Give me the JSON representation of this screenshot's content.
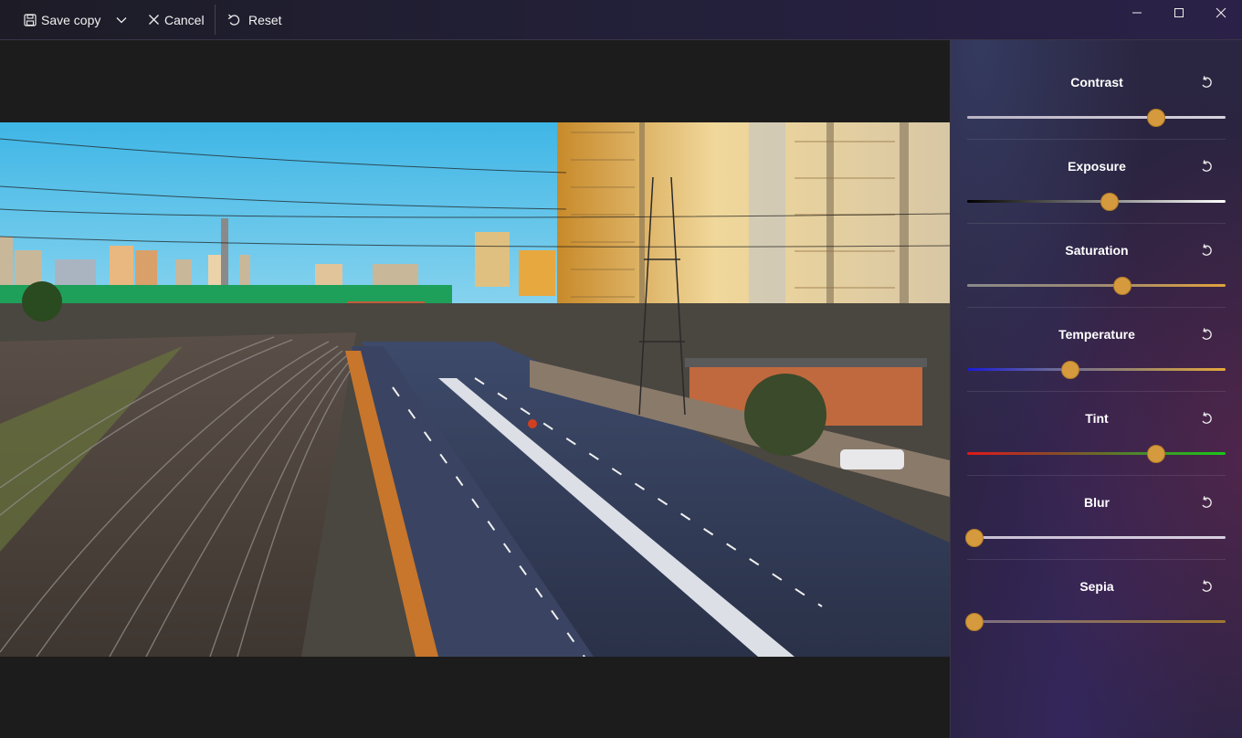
{
  "toolbar": {
    "save_copy_label": "Save copy",
    "cancel_label": "Cancel",
    "reset_label": "Reset"
  },
  "window_controls": [
    "minimize-icon",
    "maximize-icon",
    "close-icon"
  ],
  "adjustments": [
    {
      "label": "Contrast",
      "value": 0.73,
      "track": "linear-gradient(90deg,#b9b3c4,#d8d3de)"
    },
    {
      "label": "Exposure",
      "value": 0.55,
      "track": "linear-gradient(90deg,#000000,#808080,#ffffff)"
    },
    {
      "label": "Saturation",
      "value": 0.6,
      "track": "linear-gradient(90deg,#8a8a8a,#9c8a73,#e1a23c)"
    },
    {
      "label": "Temperature",
      "value": 0.4,
      "track": "linear-gradient(90deg,#1a1ad8,#6a6a98,#a08a66,#e5a83a)"
    },
    {
      "label": "Tint",
      "value": 0.73,
      "track": "linear-gradient(90deg,#e01818,#8a4a2a,#4a8a2a,#18c818)"
    },
    {
      "label": "Blur",
      "value": 0.03,
      "track": "linear-gradient(90deg,#c9bfd4,#d8cfe0)"
    },
    {
      "label": "Sepia",
      "value": 0.03,
      "track": "linear-gradient(90deg,#7f6f88,#8a6f5a,#a0762e)"
    }
  ],
  "colors": {
    "accent": "#d59a3d",
    "panel_bg": "#2b2442",
    "canvas_bg": "#1c1c1c"
  }
}
